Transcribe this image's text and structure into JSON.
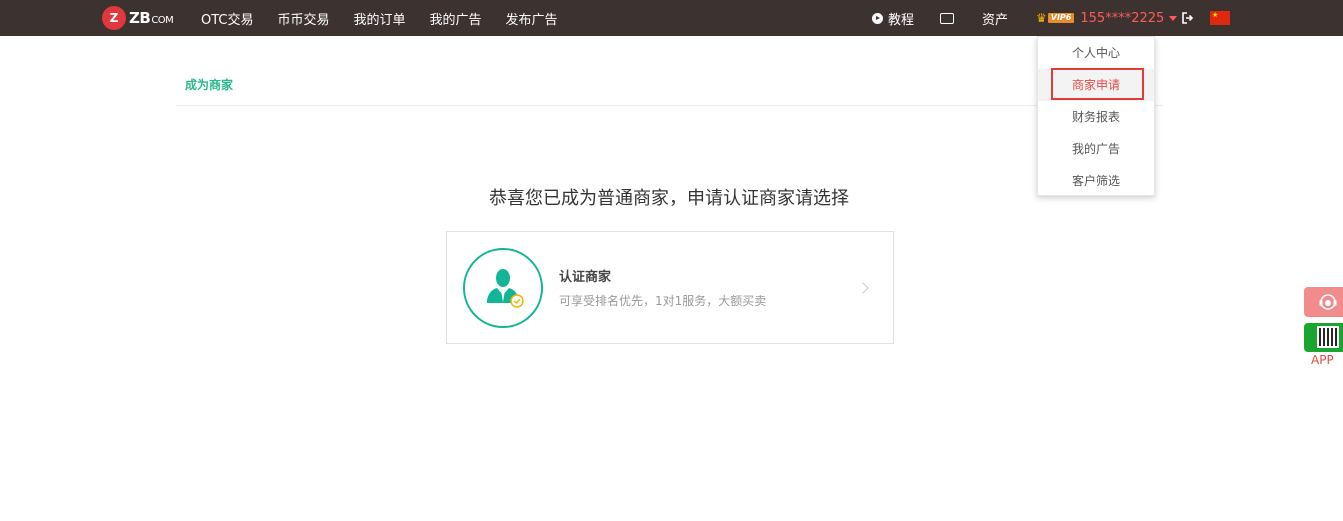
{
  "header": {
    "logo_badge": "Z",
    "logo_text": "ZB",
    "logo_domain": "COM",
    "nav": [
      "OTC交易",
      "币币交易",
      "我的订单",
      "我的广告",
      "发布广告"
    ],
    "tutorial": "教程",
    "assets": "资产",
    "vip_label": "VIP6",
    "user_phone": "155****2225"
  },
  "breadcrumb": "成为商家",
  "headline": "恭喜您已成为普通商家，申请认证商家请选择",
  "card": {
    "title": "认证商家",
    "description": "可享受排名优先，1对1服务，大额买卖"
  },
  "dropdown": {
    "items": [
      "个人中心",
      "商家申请",
      "财务报表",
      "我的广告",
      "客户筛选"
    ],
    "active_index": 1
  },
  "side": {
    "app_label": "APP"
  },
  "colors": {
    "header_bg": "#3c3230",
    "accent_green": "#13b597",
    "accent_red": "#e24a4a"
  }
}
